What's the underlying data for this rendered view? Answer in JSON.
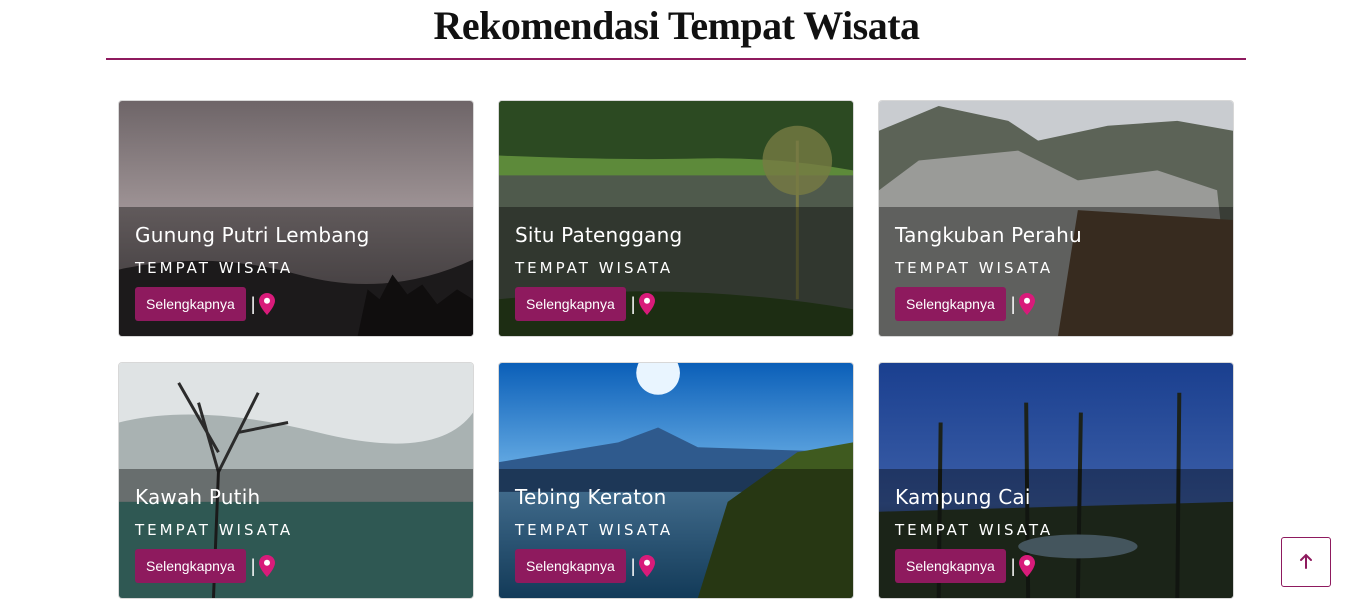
{
  "page": {
    "title": "Rekomendasi Tempat Wisata"
  },
  "colors": {
    "accent": "#8e1a5e",
    "pin": "#d81b7a"
  },
  "cards": [
    {
      "title": "Gunung Putri Lembang",
      "subtitle": "TEMPAT WISATA",
      "button": "Selengkapnya",
      "separator": "|",
      "icon": "map-pin-icon"
    },
    {
      "title": "Situ Patenggang",
      "subtitle": "TEMPAT WISATA",
      "button": "Selengkapnya",
      "separator": "|",
      "icon": "map-pin-icon"
    },
    {
      "title": "Tangkuban Perahu",
      "subtitle": "TEMPAT WISATA",
      "button": "Selengkapnya",
      "separator": "|",
      "icon": "map-pin-icon"
    },
    {
      "title": "Kawah Putih",
      "subtitle": "TEMPAT WISATA",
      "button": "Selengkapnya",
      "separator": "|",
      "icon": "map-pin-icon"
    },
    {
      "title": "Tebing Keraton",
      "subtitle": "TEMPAT WISATA",
      "button": "Selengkapnya",
      "separator": "|",
      "icon": "map-pin-icon"
    },
    {
      "title": "Kampung Cai",
      "subtitle": "TEMPAT WISATA",
      "button": "Selengkapnya",
      "separator": "|",
      "icon": "map-pin-icon"
    }
  ],
  "scroll_top": {
    "icon": "arrow-up-icon"
  }
}
